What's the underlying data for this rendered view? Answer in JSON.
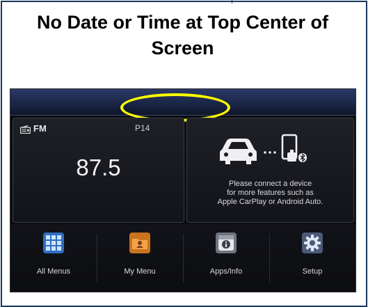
{
  "headline": {
    "line1": "No Date or Time at Top Center of",
    "line2": "Screen"
  },
  "colors": {
    "frame": "#17375e",
    "highlight": "#ffff00",
    "screen_bg": "#0b0c10"
  },
  "radio": {
    "band": "FM",
    "preset": "P14",
    "frequency": "87.5",
    "icon": "radio-icon"
  },
  "connect": {
    "icon": "car-phone-connect-icon",
    "message_line1": "Please connect a device",
    "message_line2": "for more features such as",
    "message_line3": "Apple CarPlay or Android Auto."
  },
  "dock": {
    "items": [
      {
        "label": "All Menus",
        "icon": "grid-icon"
      },
      {
        "label": "My Menu",
        "icon": "folder-user-icon"
      },
      {
        "label": "Apps/Info",
        "icon": "apps-info-icon"
      },
      {
        "label": "Setup",
        "icon": "gear-icon"
      }
    ]
  }
}
